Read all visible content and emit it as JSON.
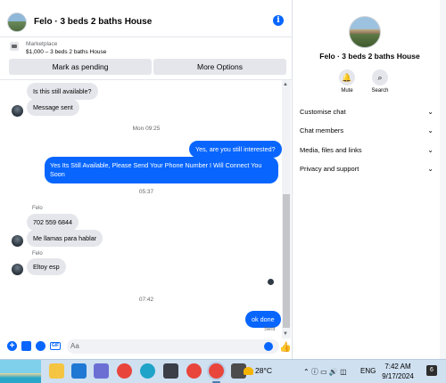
{
  "chat_header": {
    "title": "Felo · 3 beds 2 baths House"
  },
  "marketplace": {
    "label": "Marketplace",
    "item": "$1,000 – 3 beds 2 baths House",
    "pending_button": "Mark as pending",
    "more_button": "More Options"
  },
  "messages": {
    "m1": "Is this still available?",
    "m2": "Message sent",
    "time1": "Mon 09:25",
    "m3": "Yes, are you still interested?",
    "m4_line1": "Yes Its Still Available, Please Send Your Phone Number I Will Connect You",
    "m4_line2": "Soon",
    "time2": "05:37",
    "sender1": "Felo",
    "m5": "702 559 6844",
    "m6": "Me llamas para hablar",
    "sender2": "Felo",
    "m7": "Eltoy esp",
    "time3": "07:42",
    "m8": "ok done",
    "sent": "Sent"
  },
  "composer": {
    "placeholder": "Aa"
  },
  "info_panel": {
    "title": "Felo · 3 beds 2 baths House",
    "mute": "Mute",
    "search": "Search",
    "options": [
      "Customise chat",
      "Chat members",
      "Media, files and links",
      "Privacy and support"
    ]
  },
  "taskbar": {
    "temperature": "28°C",
    "lang": "ENG",
    "time": "7:42 AM",
    "date": "9/17/2024",
    "notifications": "6"
  },
  "colors": {
    "accent": "#0866ff",
    "bubble_in": "#e4e6eb",
    "taskbar": "#cfe0f1"
  }
}
